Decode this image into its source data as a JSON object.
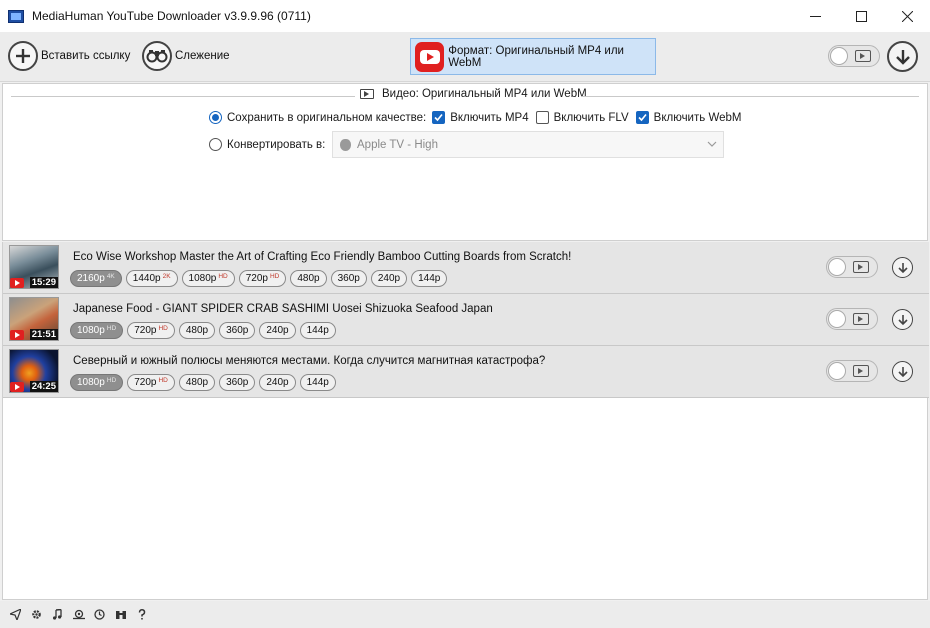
{
  "window": {
    "title": "MediaHuman YouTube Downloader v3.9.9.96 (0711)"
  },
  "toolbar": {
    "paste_label": "Вставить ссылку",
    "tracking_label": "Слежение",
    "format_label": "Формат: Оригинальный MP4 или WebM"
  },
  "settings": {
    "header": "Видео: Оригинальный MP4 или WebM",
    "save_original_label": "Сохранить в оригинальном качестве:",
    "include_mp4_label": "Включить MP4",
    "include_flv_label": "Включить FLV",
    "include_webm_label": "Включить WebM",
    "include_mp4": true,
    "include_flv": false,
    "include_webm": true,
    "mode": "original",
    "convert_label": "Конвертировать в:",
    "convert_value": "Apple TV - High"
  },
  "videos": [
    {
      "title": "Eco Wise Workshop Master the Art of Crafting Eco Friendly Bamboo Cutting Boards from Scratch!",
      "duration": "15:29",
      "qualities": [
        {
          "label": "2160p",
          "badge": "4K",
          "selected": true
        },
        {
          "label": "1440p",
          "badge": "2K",
          "selected": false
        },
        {
          "label": "1080p",
          "badge": "HD",
          "selected": false
        },
        {
          "label": "720p",
          "badge": "HD",
          "selected": false
        },
        {
          "label": "480p",
          "badge": "",
          "selected": false
        },
        {
          "label": "360p",
          "badge": "",
          "selected": false
        },
        {
          "label": "240p",
          "badge": "",
          "selected": false
        },
        {
          "label": "144p",
          "badge": "",
          "selected": false
        }
      ]
    },
    {
      "title": "Japanese Food - GIANT SPIDER CRAB SASHIMI Uosei Shizuoka Seafood Japan",
      "duration": "21:51",
      "qualities": [
        {
          "label": "1080p",
          "badge": "HD",
          "selected": true
        },
        {
          "label": "720p",
          "badge": "HD",
          "selected": false
        },
        {
          "label": "480p",
          "badge": "",
          "selected": false
        },
        {
          "label": "360p",
          "badge": "",
          "selected": false
        },
        {
          "label": "240p",
          "badge": "",
          "selected": false
        },
        {
          "label": "144p",
          "badge": "",
          "selected": false
        }
      ]
    },
    {
      "title": "Северный и южный полюсы меняются местами. Когда случится магнитная катастрофа?",
      "duration": "24:25",
      "qualities": [
        {
          "label": "1080p",
          "badge": "HD",
          "selected": true
        },
        {
          "label": "720p",
          "badge": "HD",
          "selected": false
        },
        {
          "label": "480p",
          "badge": "",
          "selected": false
        },
        {
          "label": "360p",
          "badge": "",
          "selected": false
        },
        {
          "label": "240p",
          "badge": "",
          "selected": false
        },
        {
          "label": "144p",
          "badge": "",
          "selected": false
        }
      ]
    }
  ],
  "statusbar": {
    "icons": [
      "send-icon",
      "gear-icon",
      "music-note-icon",
      "snail-icon",
      "clock-icon",
      "binoculars-icon",
      "help-icon"
    ]
  },
  "colors": {
    "accent": "#1565c0",
    "youtube_red": "#e02020",
    "format_button_bg": "#cfe3f8"
  }
}
